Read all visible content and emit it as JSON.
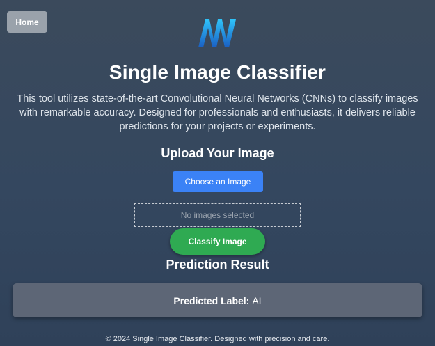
{
  "nav": {
    "home_label": "Home"
  },
  "header": {
    "logo_icon": "nn-logo-icon",
    "title": "Single Image Classifier",
    "description": "This tool utilizes state-of-the-art Convolutional Neural Networks (CNNs) to classify images with remarkable accuracy. Designed for professionals and enthusiasts, it delivers reliable predictions for your projects or experiments."
  },
  "upload": {
    "heading": "Upload Your Image",
    "choose_label": "Choose an Image",
    "dropzone_text": "No images selected",
    "classify_label": "Classify Image"
  },
  "result": {
    "heading": "Prediction Result",
    "label_key": "Predicted Label:",
    "label_value": "AI"
  },
  "footer": {
    "text": "© 2024 Single Image Classifier. Designed with precision and care."
  },
  "colors": {
    "background": "#34475f",
    "home_button": "#9aa2ab",
    "choose_button": "#3b82f6",
    "classify_button": "#2faa52",
    "result_card": "#5d6676",
    "logo_gradient_start": "#29b6f6",
    "logo_gradient_end": "#1565c0"
  }
}
